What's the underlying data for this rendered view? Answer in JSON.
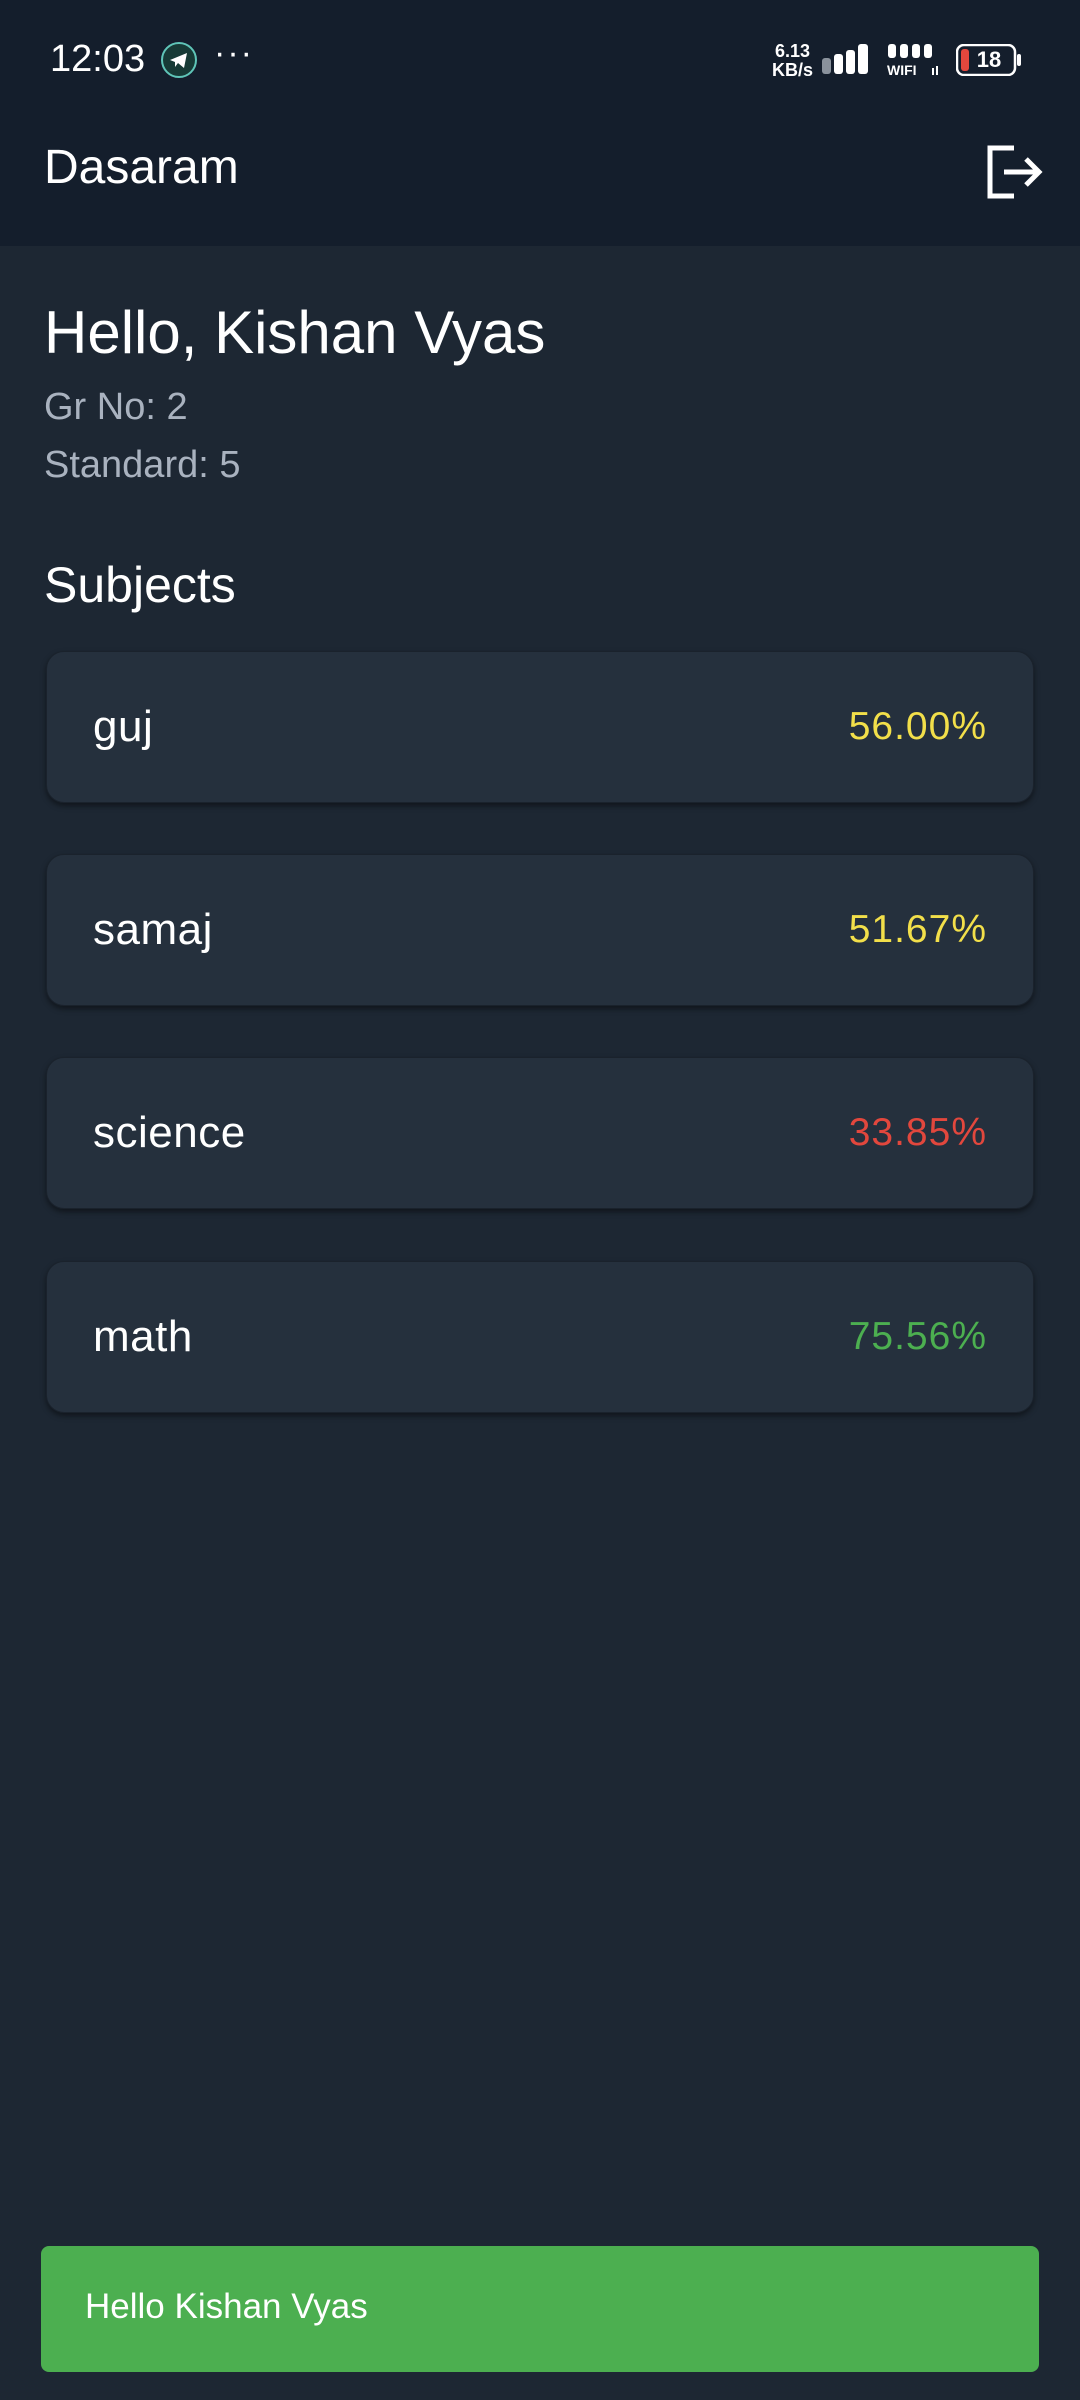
{
  "status_bar": {
    "time": "12:03",
    "more": "···",
    "net_speed_value": "6.13",
    "net_speed_unit": "KB/s",
    "wifi_label": "WIFI",
    "battery": "18"
  },
  "app_bar": {
    "title": "Dasaram",
    "logout_icon": "logout-icon"
  },
  "student": {
    "greeting": "Hello, Kishan Vyas",
    "gr_no": "Gr No: 2",
    "standard": "Standard: 5"
  },
  "subjects_heading": "Subjects",
  "subjects": [
    {
      "name": "guj",
      "percentage": "56.00%",
      "color": "#f2df4a"
    },
    {
      "name": "samaj",
      "percentage": "51.67%",
      "color": "#f2df4a"
    },
    {
      "name": "science",
      "percentage": "33.85%",
      "color": "#e2473d"
    },
    {
      "name": "math",
      "percentage": "75.56%",
      "color": "#4caf50"
    }
  ],
  "snackbar": {
    "message": "Hello Kishan Vyas",
    "color": "#4caf50"
  }
}
